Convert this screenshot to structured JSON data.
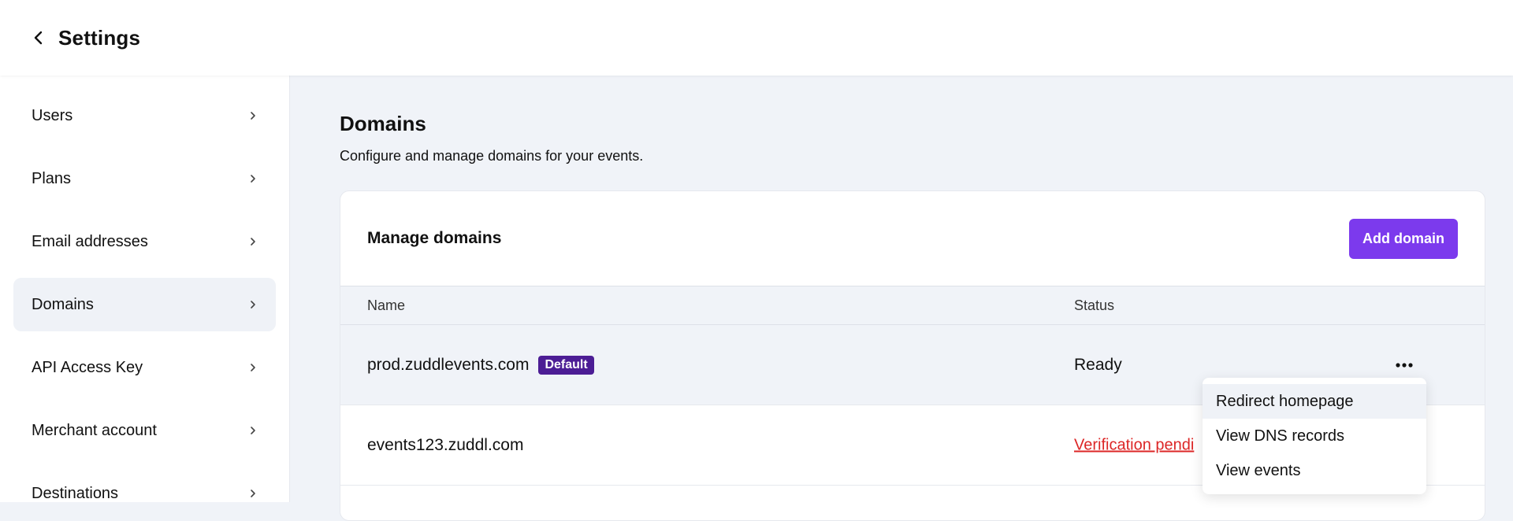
{
  "header": {
    "title": "Settings",
    "back_icon": "chevron-left-icon"
  },
  "sidebar": {
    "items": [
      {
        "label": "Users"
      },
      {
        "label": "Plans"
      },
      {
        "label": "Email addresses"
      },
      {
        "label": "Domains",
        "active": true
      },
      {
        "label": "API Access Key"
      },
      {
        "label": "Merchant account"
      },
      {
        "label": "Destinations"
      }
    ]
  },
  "main": {
    "title": "Domains",
    "description": "Configure and manage domains for your events.",
    "card": {
      "title": "Manage domains",
      "add_button": "Add domain",
      "columns": {
        "name": "Name",
        "status": "Status"
      },
      "rows": [
        {
          "name": "prod.zuddlevents.com",
          "badge": "Default",
          "status": "Ready"
        },
        {
          "name": "events123.zuddl.com",
          "status": "Verification pendi"
        }
      ]
    }
  },
  "dropdown": {
    "items": [
      {
        "label": "Redirect homepage"
      },
      {
        "label": "View DNS records"
      },
      {
        "label": "View events"
      }
    ]
  },
  "colors": {
    "accent": "#7c3aed",
    "badge": "#4c1d95",
    "error": "#dc2626"
  }
}
